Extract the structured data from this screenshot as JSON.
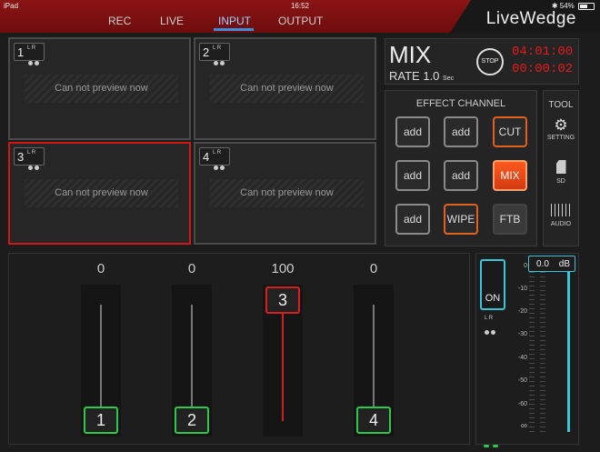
{
  "status": {
    "device": "iPad",
    "time": "16:52",
    "battery": "54%",
    "battery_level": 0.54
  },
  "tabs": [
    {
      "label": "REC",
      "active": false
    },
    {
      "label": "LIVE",
      "active": false
    },
    {
      "label": "INPUT",
      "active": true
    },
    {
      "label": "OUTPUT",
      "active": false
    }
  ],
  "brand": "LiveWedge",
  "previews": [
    {
      "number": "1",
      "lr": "L R",
      "message": "Can not preview now",
      "selected": false
    },
    {
      "number": "2",
      "lr": "L R",
      "message": "Can not preview now",
      "selected": false
    },
    {
      "number": "3",
      "lr": "L R",
      "message": "Can not preview now",
      "selected": true
    },
    {
      "number": "4",
      "lr": "L R",
      "message": "Can not preview now",
      "selected": false
    }
  ],
  "mix": {
    "title": "MIX",
    "rate_label": "RATE",
    "rate_value": "1.0",
    "rate_unit": "Sec",
    "stop_label": "STOP",
    "timer_primary": "04:01:00",
    "timer_secondary": "00:00:02"
  },
  "effect": {
    "title": "EFFECT CHANNEL",
    "buttons": [
      {
        "label": "add",
        "style": "normal"
      },
      {
        "label": "add",
        "style": "normal"
      },
      {
        "label": "CUT",
        "style": "orange"
      },
      {
        "label": "add",
        "style": "normal"
      },
      {
        "label": "add",
        "style": "normal"
      },
      {
        "label": "MIX",
        "style": "active"
      },
      {
        "label": "add",
        "style": "normal"
      },
      {
        "label": "WIPE",
        "style": "orange"
      },
      {
        "label": "FTB",
        "style": "dim"
      }
    ]
  },
  "tool": {
    "title": "TOOL",
    "items": [
      {
        "label": "SETTING",
        "icon": "gear-icon"
      },
      {
        "label": "SD",
        "icon": "sd-card-icon"
      },
      {
        "label": "AUDIO",
        "icon": "audio-mixer-icon"
      }
    ]
  },
  "faders": [
    {
      "value": "0",
      "label": "1",
      "active": false
    },
    {
      "value": "0",
      "label": "2",
      "active": false
    },
    {
      "value": "100",
      "label": "3",
      "active": true
    },
    {
      "value": "0",
      "label": "4",
      "active": false
    }
  ],
  "audio": {
    "on_label": "ON",
    "lr": "L R",
    "db_value": "0.0",
    "db_unit": "dB",
    "scale": [
      "0",
      "-10",
      "-20",
      "-30",
      "-40",
      "-50",
      "-60",
      "∞"
    ],
    "accent": "#3ac6d8"
  },
  "colors": {
    "header": "#8a1414",
    "selected": "#d01818",
    "timer": "#e41a1a",
    "fader_button": "#2ec84a",
    "mix_active": "#ff5a1e"
  }
}
